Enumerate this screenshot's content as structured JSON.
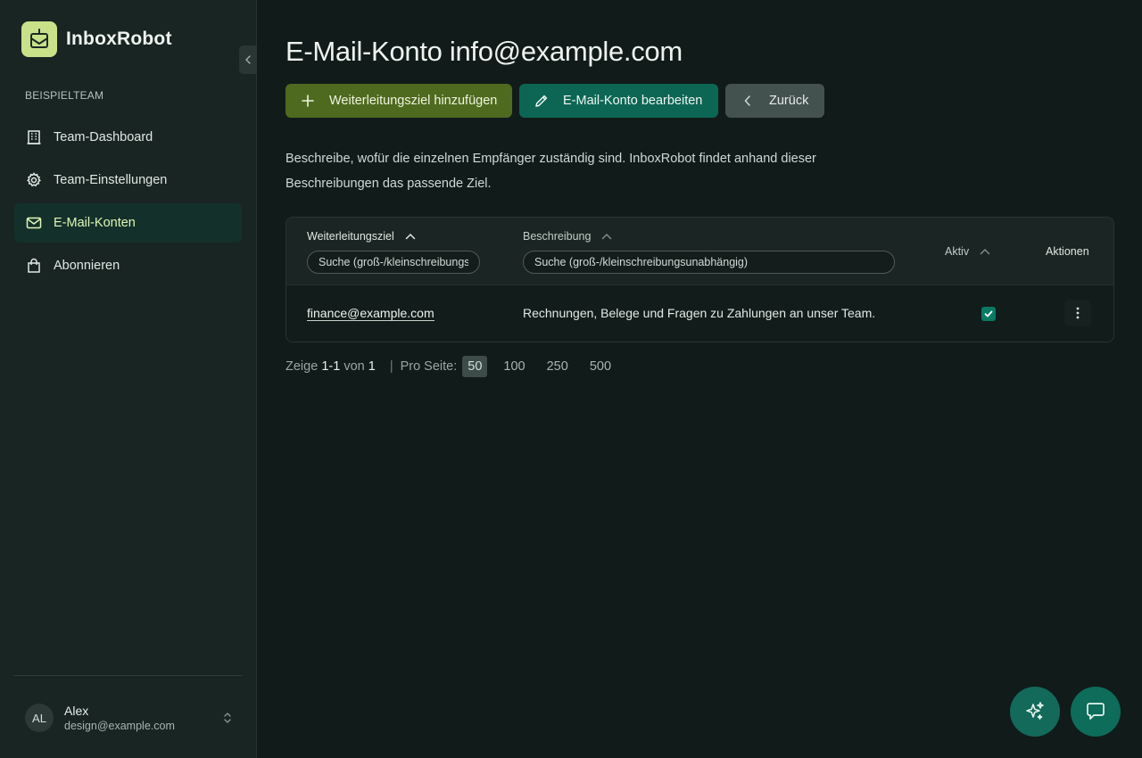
{
  "app": {
    "name": "InboxRobot"
  },
  "sidebar": {
    "team_label": "Beispielteam",
    "items": [
      {
        "label": "Team-Dashboard",
        "icon": "building-icon",
        "active": false
      },
      {
        "label": "Team-Einstellungen",
        "icon": "gear-icon",
        "active": false
      },
      {
        "label": "E-Mail-Konten",
        "icon": "mail-icon",
        "active": true
      },
      {
        "label": "Abonnieren",
        "icon": "shopping-bag-icon",
        "active": false
      }
    ],
    "user": {
      "initials": "AL",
      "name": "Alex",
      "email": "design@example.com"
    }
  },
  "page": {
    "title": "E-Mail-Konto info@example.com",
    "buttons": {
      "add": "Weiterleitungsziel hinzufügen",
      "edit": "E-Mail-Konto bearbeiten",
      "back": "Zurück"
    },
    "description": "Beschreibe, wofür die einzelnen Empfänger zuständig sind. InboxRobot findet anhand dieser Beschreibungen das passende Ziel."
  },
  "table": {
    "columns": {
      "target": "Weiterleitungsziel",
      "description": "Beschreibung",
      "active": "Aktiv",
      "actions": "Aktionen"
    },
    "filters": {
      "target_placeholder": "Suche (groß-/kleinschreibungsunabhängig)",
      "description_placeholder": "Suche (groß-/kleinschreibungsunabhängig)"
    },
    "rows": [
      {
        "email": "finance@example.com",
        "description": "Rechnungen, Belege und Fragen zu Zahlungen an unser Team.",
        "active": true
      }
    ]
  },
  "pagination": {
    "prefix": "Zeige",
    "range": "1-1",
    "of_label": "von",
    "total": "1",
    "separator": "|",
    "per_page_label": "Pro Seite:",
    "sizes": [
      "50",
      "100",
      "250",
      "500"
    ],
    "selected_size": "50"
  },
  "colors": {
    "background": "#111b1a",
    "sidebar": "#192523",
    "accent_add": "#4e6a1f",
    "accent_edit": "#0d6654",
    "logo": "#c9e28a"
  }
}
